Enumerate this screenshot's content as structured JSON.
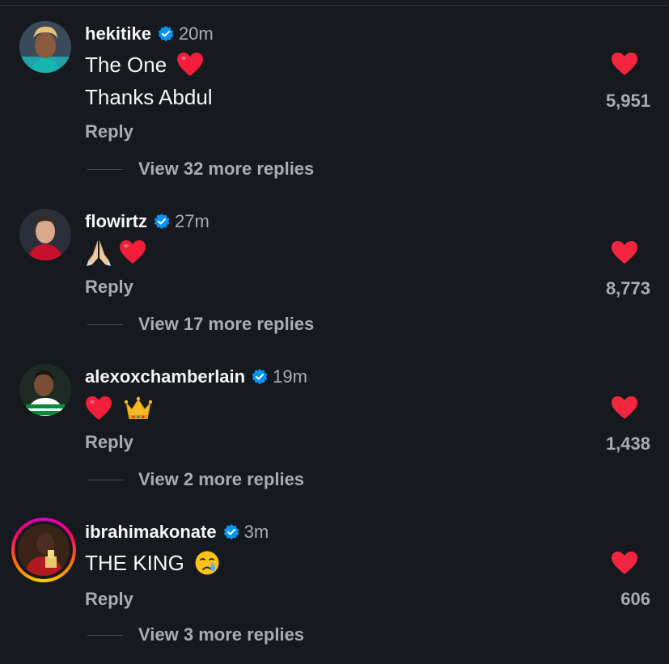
{
  "colors": {
    "background": "#16191e",
    "heart": "#f4263f",
    "verified": "#0095f6",
    "muted_text": "#a8adb5"
  },
  "comments": [
    {
      "username": "hekitike",
      "time": "20m",
      "lines": [
        "The One",
        "Thanks Abdul"
      ],
      "emoji": [
        "red-heart-emoji"
      ],
      "likes": "5,951",
      "reply_label": "Reply",
      "view_replies": "View 32 more replies"
    },
    {
      "username": "flowirtz",
      "time": "27m",
      "lines": [],
      "emoji": [
        "folded-hands-emoji",
        "red-heart-emoji"
      ],
      "likes": "8,773",
      "reply_label": "Reply",
      "view_replies": "View 17 more replies"
    },
    {
      "username": "alexoxchamberlain",
      "time": "19m",
      "lines": [],
      "emoji": [
        "red-heart-emoji",
        "crown-emoji"
      ],
      "likes": "1,438",
      "reply_label": "Reply",
      "view_replies": "View 2 more replies"
    },
    {
      "username": "ibrahimakonate",
      "time": "3m",
      "lines": [
        "THE KING"
      ],
      "emoji": [
        "crying-face-emoji"
      ],
      "likes": "606",
      "reply_label": "Reply",
      "view_replies": "View 3 more replies"
    }
  ]
}
